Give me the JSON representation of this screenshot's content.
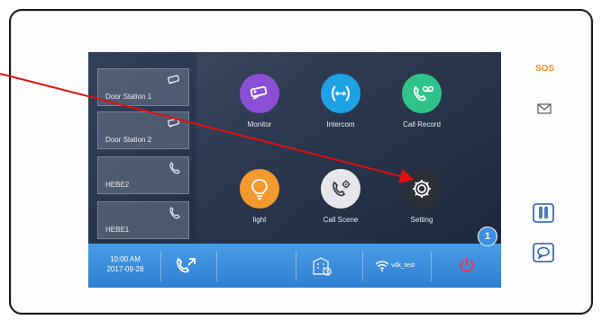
{
  "screen": {
    "entries": [
      {
        "label": "Door Station 1",
        "icon": "camera-icon"
      },
      {
        "label": "Door Station 2",
        "icon": "camera-icon"
      },
      {
        "label": "HEBE2",
        "icon": "phone-icon"
      },
      {
        "label": "HEBE1",
        "icon": "phone-icon"
      }
    ],
    "apps": [
      {
        "label": "Monitor",
        "icon": "camera-icon",
        "color": "#8b4fd6"
      },
      {
        "label": "Intercom",
        "icon": "intercom-icon",
        "color": "#1ea2e6"
      },
      {
        "label": "Call Record",
        "icon": "call-record-icon",
        "color": "#2fc38a"
      },
      {
        "label": "light",
        "icon": "lightbulb-icon",
        "color": "#f39a2e"
      },
      {
        "label": "Call Scene",
        "icon": "call-scene-icon",
        "color": "#e7e7ea"
      },
      {
        "label": "Setting",
        "icon": "gear-icon",
        "color": "#2b2f36"
      }
    ],
    "taskbar": {
      "time": "10:00 AM",
      "date": "2017-09-28",
      "wifi_name": "vdk_test",
      "icons": [
        "phone-forward-icon",
        "building-icon",
        "wifi-icon",
        "power-icon"
      ]
    },
    "badge": "1"
  },
  "device": {
    "sos_label": "SOS",
    "buttons": [
      "envelope-icon",
      "door-icon",
      "chat-icon"
    ]
  },
  "colors": {
    "accent_orange": "#ff8a1c",
    "taskbar_blue": "#3a8edb",
    "arrow_red": "#e01010",
    "power_red": "#ff2b4a"
  }
}
